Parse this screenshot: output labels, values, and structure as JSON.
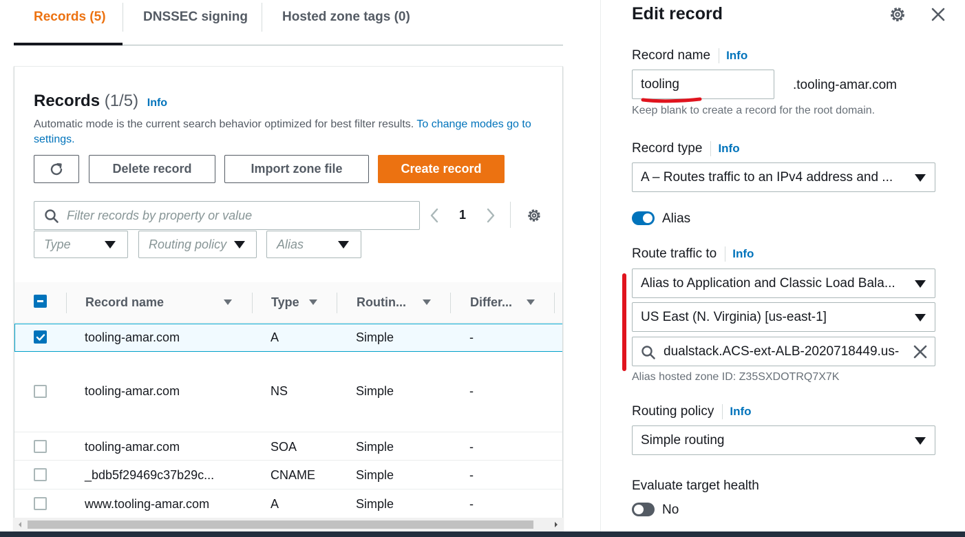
{
  "tabs": [
    {
      "label": "Records (5)"
    },
    {
      "label": "DNSSEC signing"
    },
    {
      "label": "Hosted zone tags (0)"
    }
  ],
  "records": {
    "title": "Records",
    "count": "(1/5)",
    "info": "Info",
    "description": "Automatic mode is the current search behavior optimized for best filter results.",
    "description_link": "To change modes go to settings.",
    "buttons": {
      "delete": "Delete record",
      "import": "Import zone file",
      "create": "Create record"
    },
    "search_placeholder": "Filter records by property or value",
    "filters": {
      "type": "Type",
      "routing": "Routing policy",
      "alias": "Alias"
    },
    "page": "1",
    "columns": [
      "Record name",
      "Type",
      "Routin...",
      "Differ..."
    ],
    "rows": [
      {
        "name": "tooling-amar.com",
        "type": "A",
        "routing": "Simple",
        "diff": "-",
        "selected": true
      },
      {
        "name": "tooling-amar.com",
        "type": "NS",
        "routing": "Simple",
        "diff": "-",
        "selected": false
      },
      {
        "name": "tooling-amar.com",
        "type": "SOA",
        "routing": "Simple",
        "diff": "-",
        "selected": false
      },
      {
        "name": "_bdb5f29469c37b29c...",
        "type": "CNAME",
        "routing": "Simple",
        "diff": "-",
        "selected": false
      },
      {
        "name": "www.tooling-amar.com",
        "type": "A",
        "routing": "Simple",
        "diff": "-",
        "selected": false
      }
    ]
  },
  "edit": {
    "title": "Edit record",
    "record_name_label": "Record name",
    "record_name_value": "tooling",
    "domain_suffix": ".tooling-amar.com",
    "record_name_hint": "Keep blank to create a record for the root domain.",
    "record_type_label": "Record type",
    "record_type_value": "A – Routes traffic to an IPv4 address and ...",
    "alias_label": "Alias",
    "route_label": "Route traffic to",
    "route_endpoint": "Alias to Application and Classic Load Bala...",
    "route_region": "US East (N. Virginia) [us-east-1]",
    "route_target": "dualstack.ACS-ext-ALB-2020718449.us-",
    "alias_zone": "Alias hosted zone ID: Z35SXDOTRQ7X7K",
    "routing_policy_label": "Routing policy",
    "routing_policy_value": "Simple routing",
    "eval_health_label": "Evaluate target health",
    "eval_health_value": "No",
    "info": "Info"
  },
  "colors": {
    "accent": "#ec7211",
    "link": "#0073bb",
    "annotation": "#e0141e",
    "toggle_on": "#0073bb",
    "toggle_off": "#545b64"
  },
  "icons": [
    "refresh-icon",
    "search-icon",
    "chevron-left-icon",
    "chevron-right-icon",
    "gear-icon",
    "close-icon",
    "caret-down-icon",
    "clear-icon",
    "drag-handle-icon"
  ]
}
